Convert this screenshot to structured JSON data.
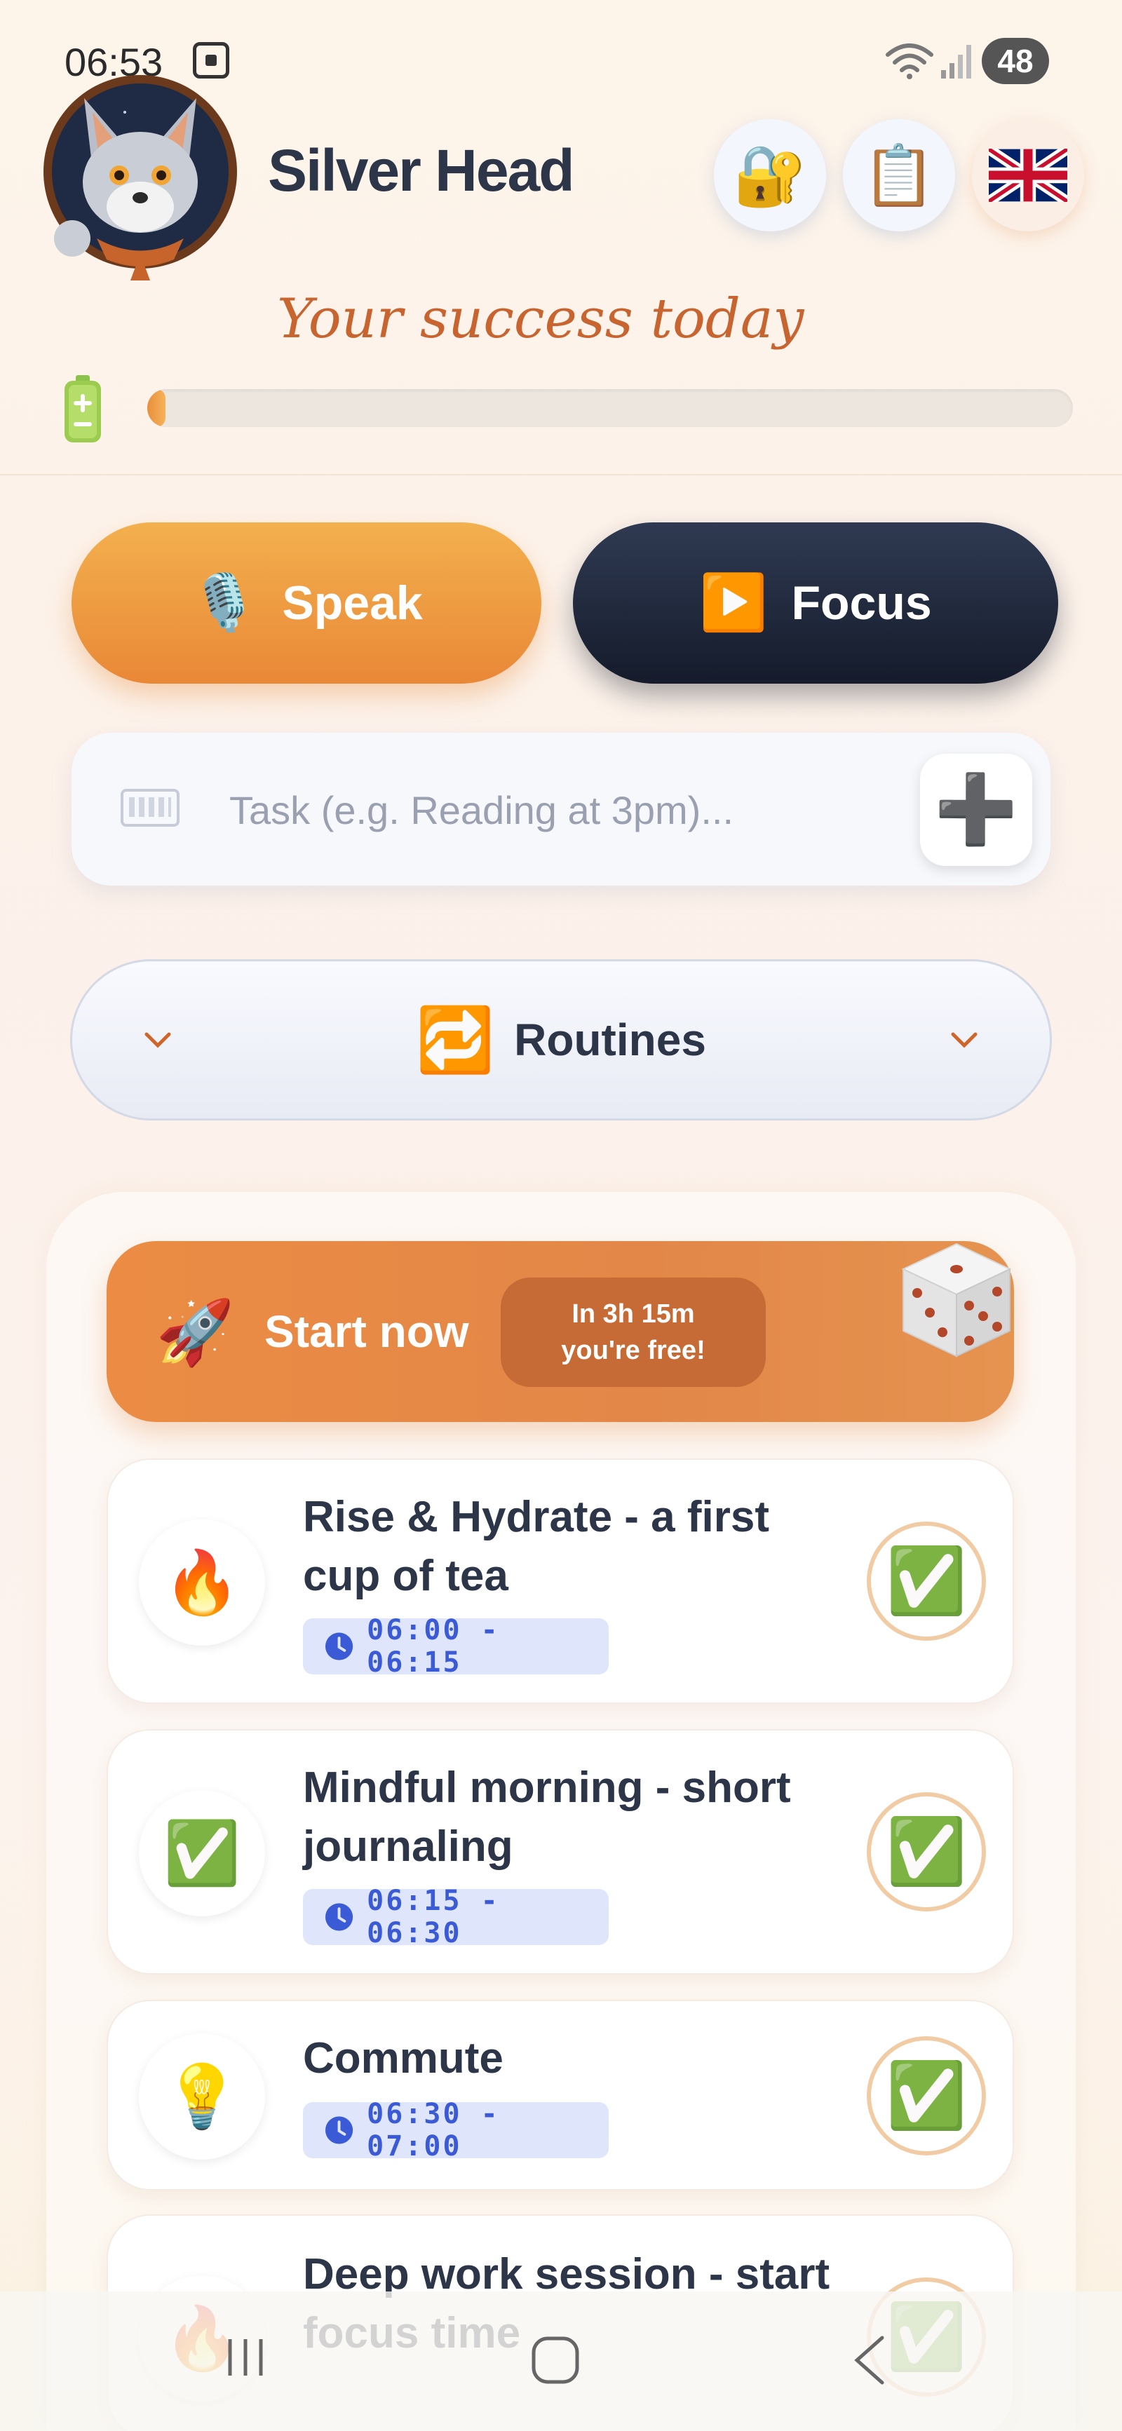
{
  "status_bar": {
    "time": "06:53",
    "battery": "48"
  },
  "header": {
    "app_title": "Silver Head",
    "success_label": "Your success today",
    "progress_fraction": 0.02,
    "buttons": {
      "lock": "🔐",
      "clipboard": "📋",
      "language": "🇬🇧"
    }
  },
  "actions": {
    "speak_label": "Speak",
    "speak_icon": "🎙️",
    "focus_label": "Focus",
    "focus_icon": "▶️"
  },
  "task_input": {
    "placeholder": "Task (e.g. Reading at 3pm)...",
    "add_label": "➕"
  },
  "routines": {
    "label": "Routines",
    "icon": "🔁"
  },
  "start_banner": {
    "label": "Start now",
    "icon": "🚀",
    "free_text": "In 3h 15m\nyou're free!"
  },
  "tasks": [
    {
      "icon": "🔥",
      "title": "Rise & Hydrate - a first cup of tea",
      "time": "06:00 - 06:15",
      "done_icon": "✅"
    },
    {
      "icon": "✅",
      "title": "Mindful morning - short journaling",
      "time": "06:15 - 06:30",
      "done_icon": "✅"
    },
    {
      "icon": "💡",
      "title": "Commute",
      "time": "06:30 - 07:00",
      "done_icon": "✅"
    },
    {
      "icon": "🔥",
      "title": "Deep work session - start focus time",
      "time": "",
      "done_icon": "✅"
    }
  ],
  "colors": {
    "accent": "#e98837",
    "dark": "#1c2335",
    "time_badge": "#3b5bd6"
  }
}
